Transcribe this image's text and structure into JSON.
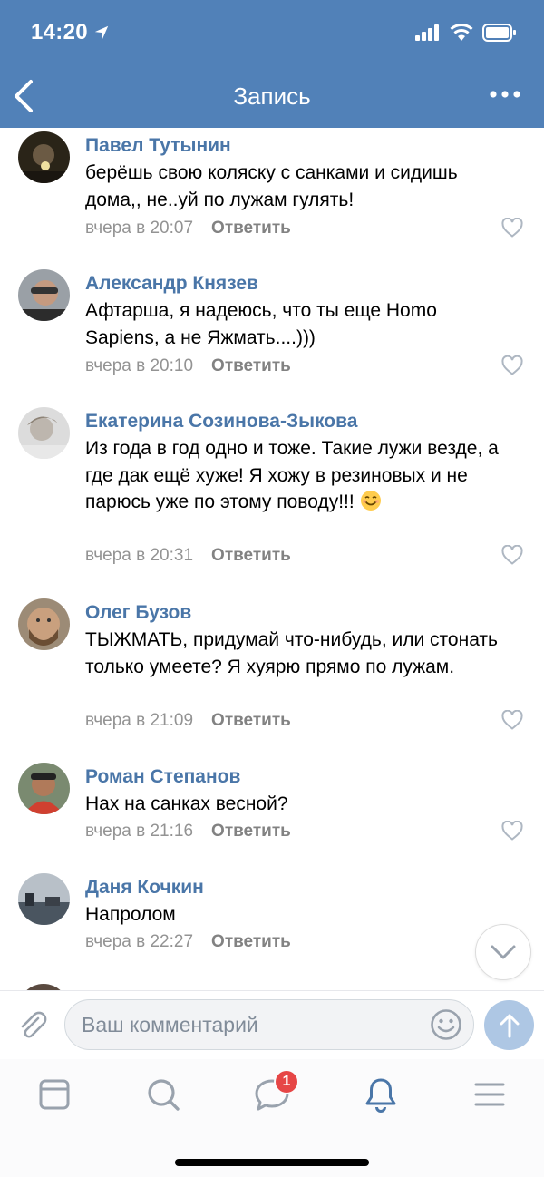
{
  "status_bar": {
    "time": "14:20"
  },
  "header": {
    "title": "Запись"
  },
  "comments": [
    {
      "author": "Павел Тутынин",
      "text": "берёшь свою коляску с санками и сидишь дома,, не..уй по лужам гулять!",
      "time": "вчера в 20:07",
      "reply": "Ответить"
    },
    {
      "author": "Александр Князев",
      "text": "Афтарша, я надеюсь, что ты еще Homo Sapiens, а не Яжмать....)))",
      "time": "вчера в 20:10",
      "reply": "Ответить"
    },
    {
      "author": "Екатерина Созинова-Зыкова",
      "text": "Из года в год одно и тоже. Такие лужи везде, а где дак ещё хуже! Я хожу в резиновых и не парюсь уже по этому поводу!!!",
      "time": "вчера в 20:31",
      "reply": "Ответить"
    },
    {
      "author": "Олег Бузов",
      "text": "ТЫЖМАТЬ, придумай что-нибудь, или стонать только умеете? Я хуярю прямо по лужам.",
      "time": "вчера в 21:09",
      "reply": "Ответить"
    },
    {
      "author": "Роман Степанов",
      "text": "Нах на санках весной?",
      "time": "вчера в 21:16",
      "reply": "Ответить"
    },
    {
      "author": "Даня Кочкин",
      "text": "Напролом",
      "time": "вчера в 22:27",
      "reply": "Ответить"
    }
  ],
  "composer": {
    "placeholder": "Ваш комментарий"
  },
  "tabbar": {
    "messages_badge": "1"
  },
  "colors": {
    "header_bg": "#5181b8",
    "author": "#4a76a8",
    "badge": "#e64646",
    "active_tab": "#4a76a8"
  }
}
